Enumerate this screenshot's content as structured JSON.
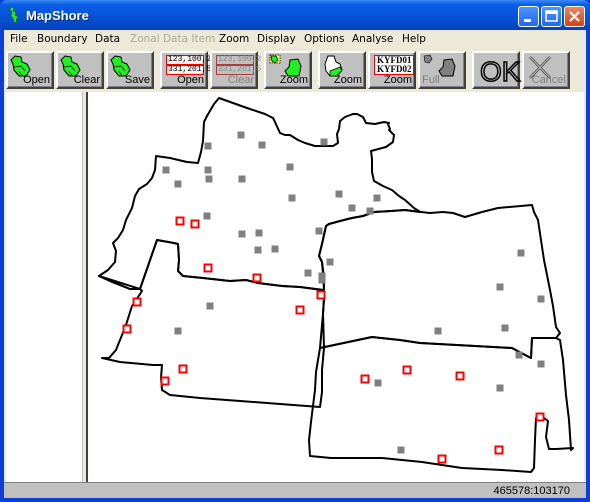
{
  "window": {
    "title": "MapShore",
    "controls": [
      "minimize",
      "maximize",
      "close"
    ]
  },
  "menu": [
    {
      "label": "File",
      "enabled": true
    },
    {
      "label": "Boundary",
      "enabled": true
    },
    {
      "label": "Data",
      "enabled": true
    },
    {
      "label": "Zonal Data Item",
      "enabled": false
    },
    {
      "label": "Zoom",
      "enabled": true
    },
    {
      "label": "Display",
      "enabled": true
    },
    {
      "label": "Options",
      "enabled": true
    },
    {
      "label": "Analyse",
      "enabled": true
    },
    {
      "label": "Help",
      "enabled": true
    }
  ],
  "toolbar": [
    {
      "id": "boundary-open",
      "icon": "green-map-icon",
      "label": "Open",
      "enabled": true
    },
    {
      "id": "boundary-clear",
      "icon": "green-map-icon",
      "label": "Clear",
      "enabled": true
    },
    {
      "id": "boundary-save",
      "icon": "green-map-icon",
      "label": "Save",
      "enabled": true
    },
    {
      "id": "data-open",
      "icon": "data-table-icon",
      "label": "Open",
      "enabled": true,
      "icon_text": [
        "123,100,2",
        "331,201,5"
      ]
    },
    {
      "id": "data-clear",
      "icon": "data-table-icon",
      "label": "Clear",
      "enabled": false,
      "icon_text": [
        "123,100,2",
        "331,201,5"
      ]
    },
    {
      "id": "zoom-area",
      "icon": "zoom-area-icon",
      "label": "Zoom",
      "enabled": true
    },
    {
      "id": "zoom-zone",
      "icon": "zoom-zone-icon",
      "label": "Zoom",
      "enabled": true
    },
    {
      "id": "zoom-code",
      "icon": "zoom-code-icon",
      "label": "Zoom",
      "enabled": true,
      "icon_text": [
        "KYFD01",
        "KYFD02"
      ]
    },
    {
      "id": "zoom-full",
      "icon": "full-extent-icon",
      "label": "Full",
      "enabled": false
    },
    {
      "id": "ok",
      "icon": "ok-icon",
      "label": "OK",
      "enabled": true
    },
    {
      "id": "cancel",
      "icon": "cancel-x-icon",
      "label": "Cancel",
      "enabled": false
    }
  ],
  "map": {
    "zones": 5,
    "point_colors": {
      "grey_marker": "#808080",
      "red_marker": "#ff0000"
    },
    "boundary_color": "#000000"
  },
  "status": {
    "coordinates": "465578:103170"
  }
}
